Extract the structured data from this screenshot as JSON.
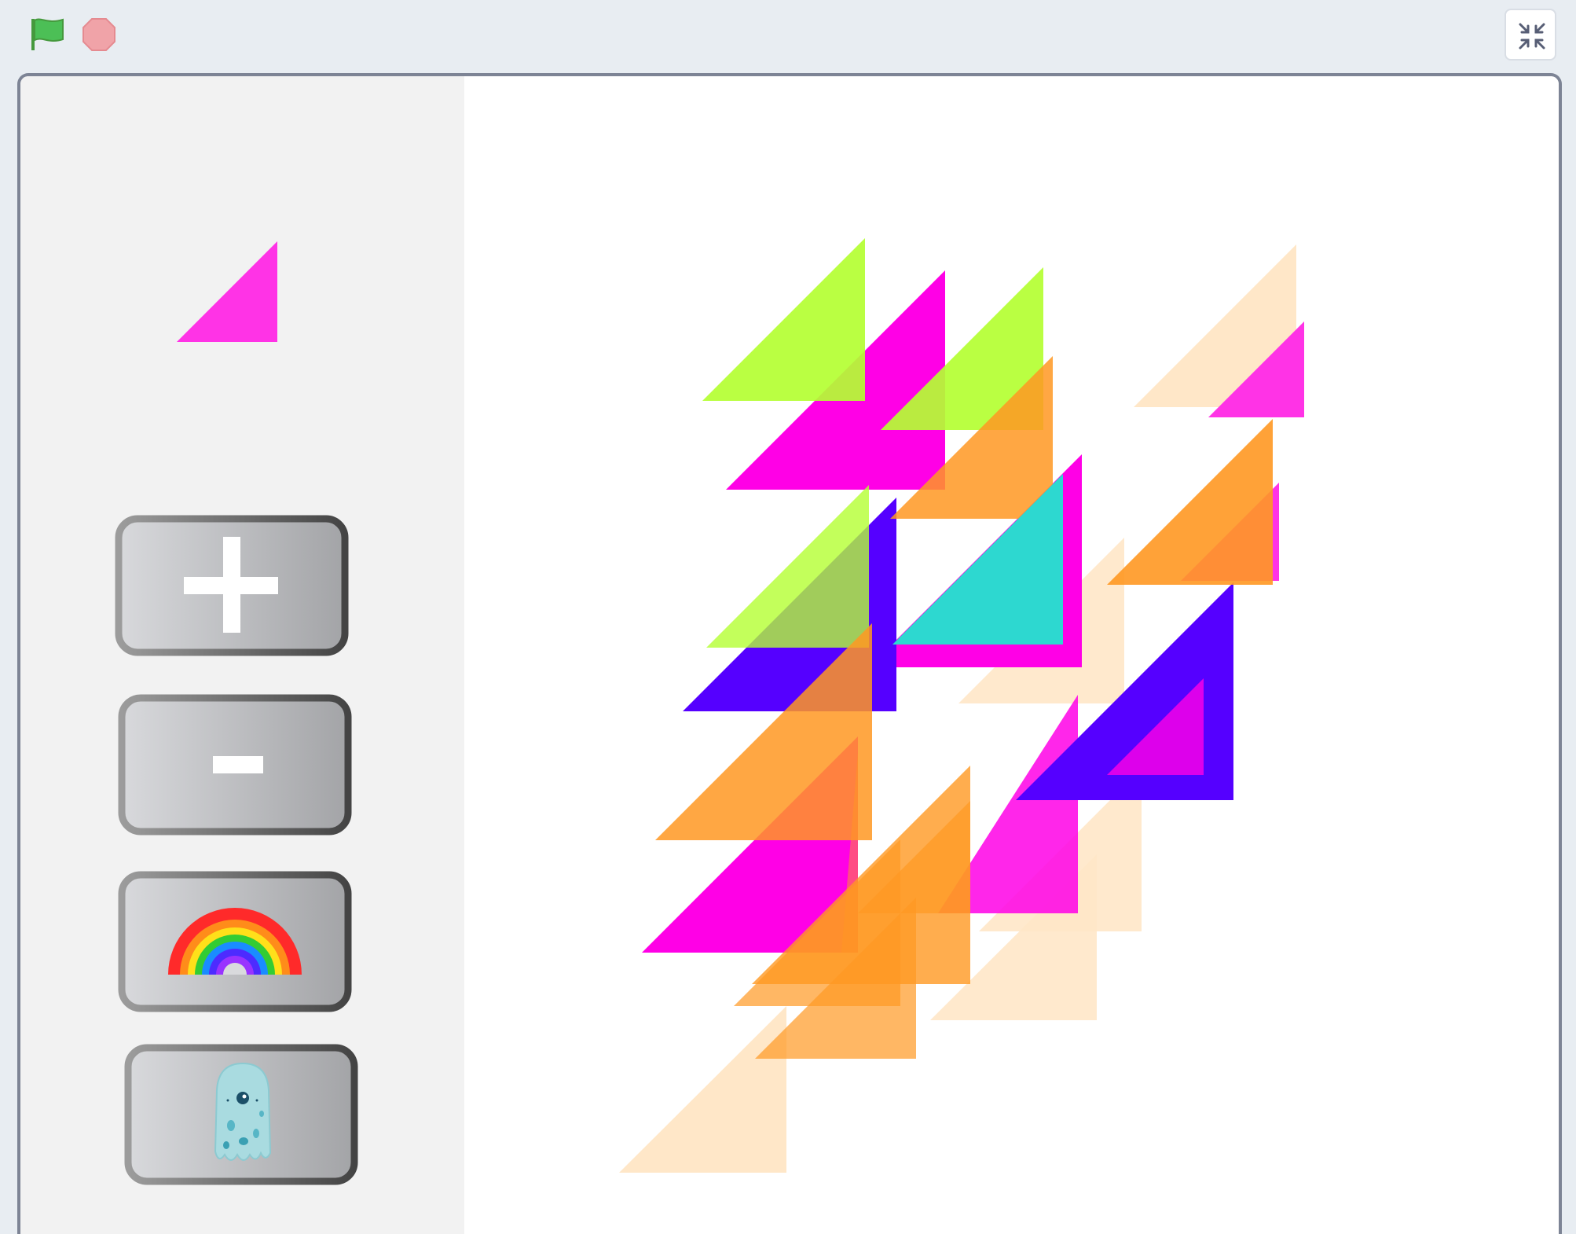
{
  "toolbar": {
    "green_flag_icon": "green-flag-icon",
    "stop_icon": "stop-sign-icon",
    "exit_fullscreen_icon": "exit-fullscreen-icon"
  },
  "stage": {
    "panel_color": "#f2f2f2",
    "canvas_color": "#ffffff",
    "frame_color": "#7d8495"
  },
  "sprites": {
    "preview": {
      "icon": "pink-triangle-icon",
      "color": "#ff33e6"
    },
    "buttons": [
      {
        "id": "plus",
        "symbol": "+"
      },
      {
        "id": "minus",
        "symbol": "-"
      },
      {
        "id": "rainbow",
        "icon": "rainbow-icon"
      },
      {
        "id": "ghost",
        "icon": "ghost-monster-icon"
      }
    ]
  },
  "palette": {
    "lime": "#b4ff32",
    "magenta": "#ff00e6",
    "orange": "#ff9822",
    "violet": "#5500ff",
    "cyan": "#2dd8d0",
    "peach": "#ffe7c8",
    "pink": "#ff33e6"
  }
}
